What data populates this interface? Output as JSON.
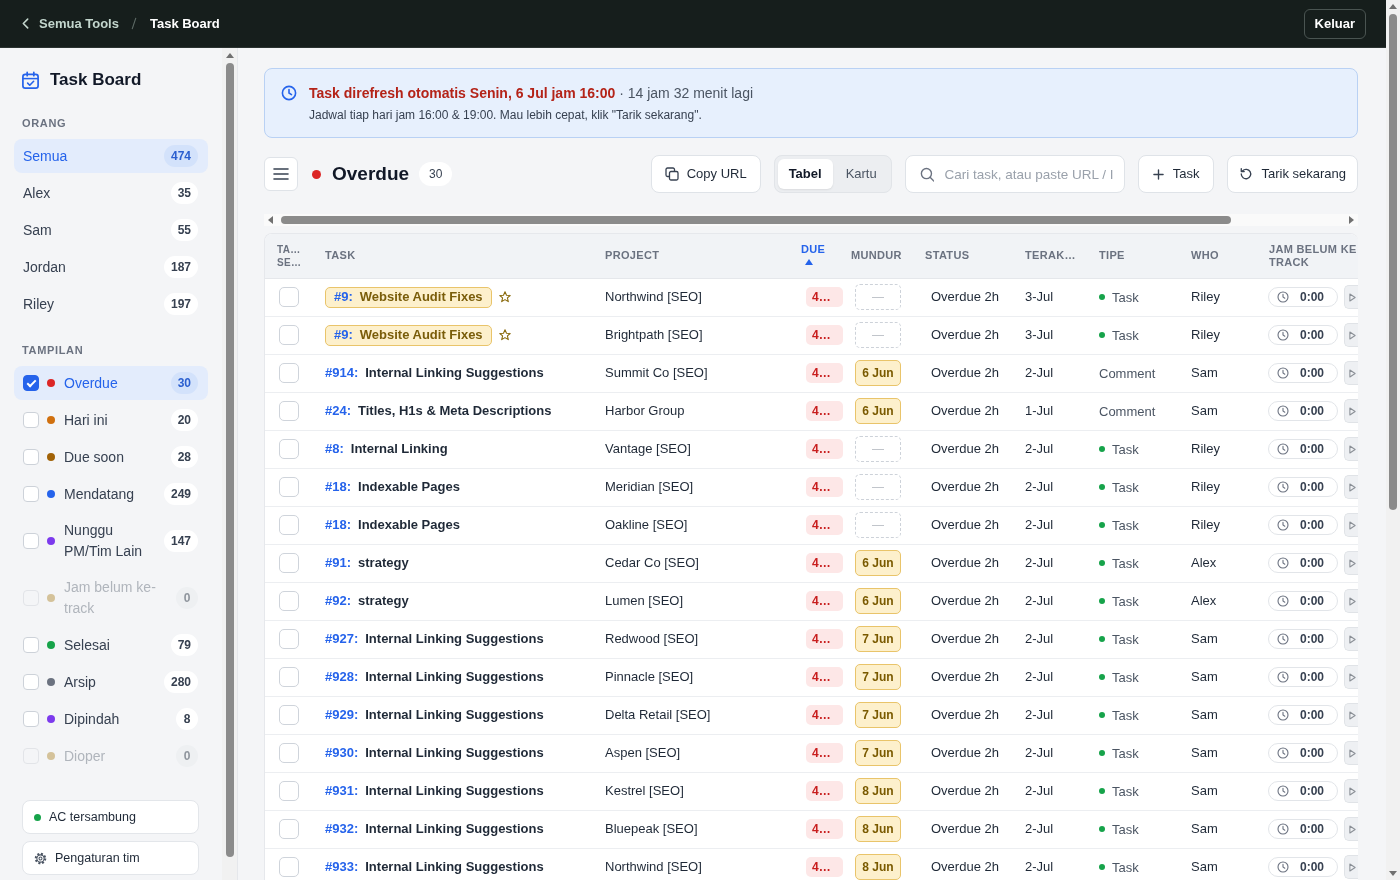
{
  "top_bar": {
    "breadcrumb": [
      {
        "label": "Semua Tools"
      },
      {
        "label": "Task Board"
      }
    ],
    "logout_button": "Keluar"
  },
  "sidebar": {
    "title": "Task Board",
    "people_heading": "ORANG",
    "people": [
      {
        "name": "Semua",
        "count": "474",
        "selected": true
      },
      {
        "name": "Alex",
        "count": "35",
        "selected": false
      },
      {
        "name": "Sam",
        "count": "55",
        "selected": false
      },
      {
        "name": "Jordan",
        "count": "187",
        "selected": false
      },
      {
        "name": "Riley",
        "count": "197",
        "selected": false
      }
    ],
    "views_heading": "TAMPILAN",
    "views": [
      {
        "label": "Overdue",
        "count": "30",
        "color": "#dc2626",
        "checked": true,
        "selected": true,
        "disabled": false
      },
      {
        "label": "Hari ini",
        "count": "20",
        "color": "#d0700f",
        "checked": false,
        "selected": false,
        "disabled": false
      },
      {
        "label": "Due soon",
        "count": "28",
        "color": "#a16207",
        "checked": false,
        "selected": false,
        "disabled": false
      },
      {
        "label": "Mendatang",
        "count": "249",
        "color": "#2563eb",
        "checked": false,
        "selected": false,
        "disabled": false
      },
      {
        "label": "Nunggu PM/Tim Lain",
        "count": "147",
        "color": "#7c3aed",
        "checked": false,
        "selected": false,
        "disabled": false
      },
      {
        "label": "Jam belum ke-track",
        "count": "0",
        "color": "#d4c29a",
        "checked": false,
        "selected": false,
        "disabled": true
      },
      {
        "label": "Selesai",
        "count": "79",
        "color": "#16a34a",
        "checked": false,
        "selected": false,
        "disabled": false
      },
      {
        "label": "Arsip",
        "count": "280",
        "color": "#6b7280",
        "checked": false,
        "selected": false,
        "disabled": false
      },
      {
        "label": "Dipindah",
        "count": "8",
        "color": "#7c3aed",
        "checked": false,
        "selected": false,
        "disabled": false
      },
      {
        "label": "Dioper",
        "count": "0",
        "color": "#d4c29a",
        "checked": false,
        "selected": false,
        "disabled": true
      }
    ],
    "connection": {
      "label": "AC tersambung",
      "connected": true
    },
    "settings_button": "Pengaturan tim"
  },
  "banner": {
    "title": "Task direfresh otomatis Senin, 6 Jul jam 16:00",
    "countdown": "· 14 jam 32 menit lagi",
    "note": "Jadwal tiap hari jam 16:00 & 19:00. Mau lebih cepat, klik \"Tarik sekarang\"."
  },
  "toolbar": {
    "view": {
      "color": "#dc2626",
      "title": "Overdue",
      "count": "30"
    },
    "copy_button": "Copy URL",
    "view_modes": [
      {
        "label": "Tabel",
        "selected": true
      },
      {
        "label": "Kartu",
        "selected": false
      }
    ],
    "search": {
      "placeholder": "Cari task, atau paste URL / I"
    },
    "add_button": "Task",
    "refresh_button": "Tarik sekarang"
  },
  "table": {
    "columns": [
      {
        "label": "TA… SE…",
        "sorted": false
      },
      {
        "label": "TASK",
        "sorted": false
      },
      {
        "label": "PROJECT",
        "sorted": false
      },
      {
        "label": "DUE",
        "sorted": true
      },
      {
        "label": "MUNDUR",
        "sorted": false
      },
      {
        "label": "STATUS",
        "sorted": false
      },
      {
        "label": "TERAK…",
        "sorted": false
      },
      {
        "label": "TIPE",
        "sorted": false
      },
      {
        "label": "WHO",
        "sorted": false
      },
      {
        "label": "JAM BELUM KE TRACK",
        "sorted": false
      }
    ],
    "rows": [
      {
        "checked": false,
        "highlighted": true,
        "task_id": "#9:",
        "task_title": "Website Audit Fixes",
        "project": "Northwind [SEO]",
        "due": "4…",
        "mundur": {
          "kind": "empty",
          "text": "—"
        },
        "status": "Overdue 2h",
        "terak": "3-Jul",
        "tipe": {
          "label": "Task",
          "dot": true
        },
        "who": "Riley",
        "jam": "0:00"
      },
      {
        "checked": false,
        "highlighted": true,
        "task_id": "#9:",
        "task_title": "Website Audit Fixes",
        "project": "Brightpath [SEO]",
        "due": "4…",
        "mundur": {
          "kind": "empty",
          "text": "—"
        },
        "status": "Overdue 2h",
        "terak": "3-Jul",
        "tipe": {
          "label": "Task",
          "dot": true
        },
        "who": "Riley",
        "jam": "0:00"
      },
      {
        "checked": false,
        "highlighted": false,
        "task_id": "#914:",
        "task_title": "Internal Linking Suggestions",
        "project": "Summit Co [SEO]",
        "due": "4…",
        "mundur": {
          "kind": "date",
          "text": "6 Jun"
        },
        "status": "Overdue 2h",
        "terak": "2-Jul",
        "tipe": {
          "label": "Comment",
          "dot": false
        },
        "who": "Sam",
        "jam": "0:00"
      },
      {
        "checked": false,
        "highlighted": false,
        "task_id": "#24:",
        "task_title": "Titles, H1s & Meta Descriptions",
        "project": "Harbor Group",
        "due": "4…",
        "mundur": {
          "kind": "date",
          "text": "6 Jun"
        },
        "status": "Overdue 2h",
        "terak": "1-Jul",
        "tipe": {
          "label": "Comment",
          "dot": false
        },
        "who": "Sam",
        "jam": "0:00"
      },
      {
        "checked": false,
        "highlighted": false,
        "task_id": "#8:",
        "task_title": "Internal Linking",
        "project": "Vantage [SEO]",
        "due": "4…",
        "mundur": {
          "kind": "empty",
          "text": "—"
        },
        "status": "Overdue 2h",
        "terak": "2-Jul",
        "tipe": {
          "label": "Task",
          "dot": true
        },
        "who": "Riley",
        "jam": "0:00"
      },
      {
        "checked": false,
        "highlighted": false,
        "task_id": "#18:",
        "task_title": "Indexable Pages",
        "project": "Meridian [SEO]",
        "due": "4…",
        "mundur": {
          "kind": "empty",
          "text": "—"
        },
        "status": "Overdue 2h",
        "terak": "2-Jul",
        "tipe": {
          "label": "Task",
          "dot": true
        },
        "who": "Riley",
        "jam": "0:00"
      },
      {
        "checked": false,
        "highlighted": false,
        "task_id": "#18:",
        "task_title": "Indexable Pages",
        "project": "Oakline [SEO]",
        "due": "4…",
        "mundur": {
          "kind": "empty",
          "text": "—"
        },
        "status": "Overdue 2h",
        "terak": "2-Jul",
        "tipe": {
          "label": "Task",
          "dot": true
        },
        "who": "Riley",
        "jam": "0:00"
      },
      {
        "checked": false,
        "highlighted": false,
        "task_id": "#91:",
        "task_title": "strategy",
        "project": "Cedar Co [SEO]",
        "due": "4…",
        "mundur": {
          "kind": "date",
          "text": "6 Jun"
        },
        "status": "Overdue 2h",
        "terak": "2-Jul",
        "tipe": {
          "label": "Task",
          "dot": true
        },
        "who": "Alex",
        "jam": "0:00"
      },
      {
        "checked": false,
        "highlighted": false,
        "task_id": "#92:",
        "task_title": "strategy",
        "project": "Lumen [SEO]",
        "due": "4…",
        "mundur": {
          "kind": "date",
          "text": "6 Jun"
        },
        "status": "Overdue 2h",
        "terak": "2-Jul",
        "tipe": {
          "label": "Task",
          "dot": true
        },
        "who": "Alex",
        "jam": "0:00"
      },
      {
        "checked": false,
        "highlighted": false,
        "task_id": "#927:",
        "task_title": "Internal Linking Suggestions",
        "project": "Redwood [SEO]",
        "due": "4…",
        "mundur": {
          "kind": "date",
          "text": "7 Jun"
        },
        "status": "Overdue 2h",
        "terak": "2-Jul",
        "tipe": {
          "label": "Task",
          "dot": true
        },
        "who": "Sam",
        "jam": "0:00"
      },
      {
        "checked": false,
        "highlighted": false,
        "task_id": "#928:",
        "task_title": "Internal Linking Suggestions",
        "project": "Pinnacle [SEO]",
        "due": "4…",
        "mundur": {
          "kind": "date",
          "text": "7 Jun"
        },
        "status": "Overdue 2h",
        "terak": "2-Jul",
        "tipe": {
          "label": "Task",
          "dot": true
        },
        "who": "Sam",
        "jam": "0:00"
      },
      {
        "checked": false,
        "highlighted": false,
        "task_id": "#929:",
        "task_title": "Internal Linking Suggestions",
        "project": "Delta Retail [SEO]",
        "due": "4…",
        "mundur": {
          "kind": "date",
          "text": "7 Jun"
        },
        "status": "Overdue 2h",
        "terak": "2-Jul",
        "tipe": {
          "label": "Task",
          "dot": true
        },
        "who": "Sam",
        "jam": "0:00"
      },
      {
        "checked": false,
        "highlighted": false,
        "task_id": "#930:",
        "task_title": "Internal Linking Suggestions",
        "project": "Aspen [SEO]",
        "due": "4…",
        "mundur": {
          "kind": "date",
          "text": "7 Jun"
        },
        "status": "Overdue 2h",
        "terak": "2-Jul",
        "tipe": {
          "label": "Task",
          "dot": true
        },
        "who": "Sam",
        "jam": "0:00"
      },
      {
        "checked": false,
        "highlighted": false,
        "task_id": "#931:",
        "task_title": "Internal Linking Suggestions",
        "project": "Kestrel [SEO]",
        "due": "4…",
        "mundur": {
          "kind": "date",
          "text": "8 Jun"
        },
        "status": "Overdue 2h",
        "terak": "2-Jul",
        "tipe": {
          "label": "Task",
          "dot": true
        },
        "who": "Sam",
        "jam": "0:00"
      },
      {
        "checked": false,
        "highlighted": false,
        "task_id": "#932:",
        "task_title": "Internal Linking Suggestions",
        "project": "Bluepeak [SEO]",
        "due": "4…",
        "mundur": {
          "kind": "date",
          "text": "8 Jun"
        },
        "status": "Overdue 2h",
        "terak": "2-Jul",
        "tipe": {
          "label": "Task",
          "dot": true
        },
        "who": "Sam",
        "jam": "0:00"
      },
      {
        "checked": false,
        "highlighted": false,
        "task_id": "#933:",
        "task_title": "Internal Linking Suggestions",
        "project": "Northwind [SEO]",
        "due": "4…",
        "mundur": {
          "kind": "date",
          "text": "8 Jun"
        },
        "status": "Overdue 2h",
        "terak": "2-Jul",
        "tipe": {
          "label": "Task",
          "dot": true
        },
        "who": "Sam",
        "jam": "0:00"
      }
    ]
  }
}
